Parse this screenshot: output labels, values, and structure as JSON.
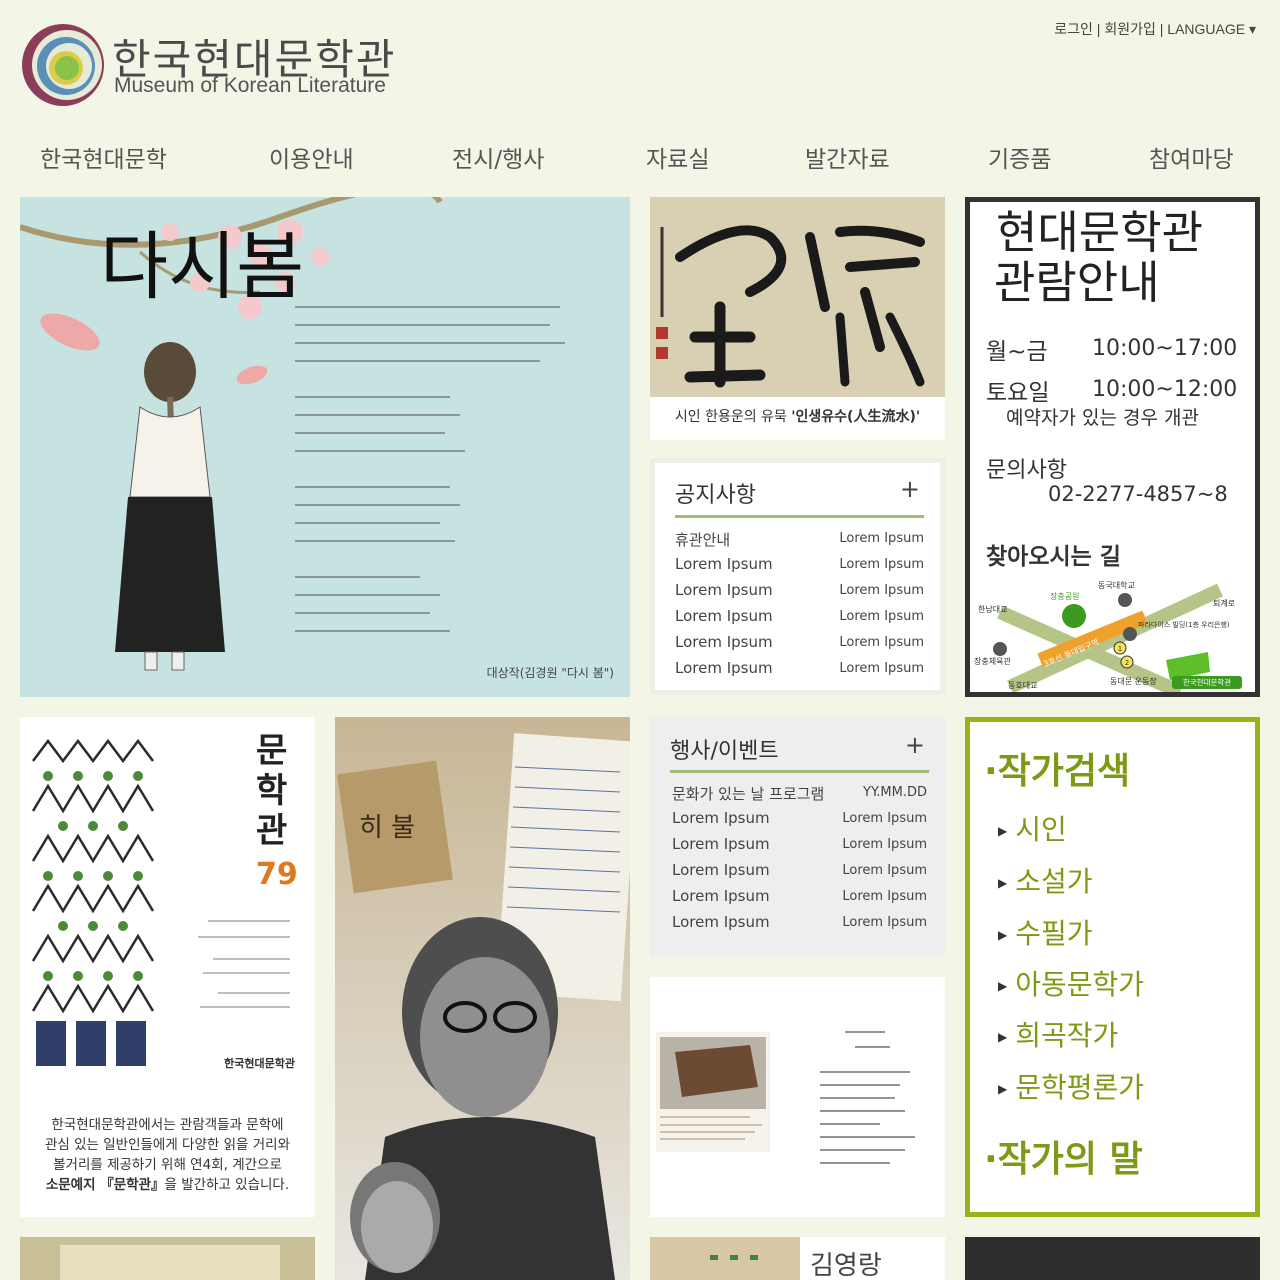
{
  "header": {
    "logo_ko": "한국현대문학관",
    "logo_en": "Museum of Korean Literature",
    "util": {
      "login": "로그인",
      "sep1": " | ",
      "join": "회원가입",
      "sep2": " | ",
      "language": "LANGUAGE ▾"
    }
  },
  "nav": [
    "한국현대문학",
    "이용안내",
    "전시/행사",
    "자료실",
    "발간자료",
    "기증품",
    "참여마당"
  ],
  "poster": {
    "title": "다시봄",
    "caption": "대상작(김경원 \"다시 봄\")"
  },
  "calligraphy": {
    "caption_prefix": "시인 한용운의 유묵 ",
    "caption_bold": "'인생유수(人生流水)'"
  },
  "info": {
    "title1": "현대문학관",
    "title2": "관람안내",
    "rows": [
      {
        "label": "월~금",
        "value": "10:00~17:00"
      },
      {
        "label": "토요일",
        "value": "10:00~12:00"
      }
    ],
    "note": "예약자가 있는 경우 개관",
    "contact_label": "문의사항",
    "phone": "02-2277-4857~8",
    "directions": "찾아오시는 길",
    "map": {
      "labels": [
        "장충공원",
        "동국대학교",
        "퇴계로",
        "한남대교",
        "파라다이스 빌딩(1층 우리은행)",
        "장충체육관",
        "3호선 동대입구역",
        "동호대교",
        "동대문 운동장",
        "한국현대문학관"
      ],
      "exits": [
        "1",
        "2"
      ],
      "colors": {
        "road": "#b5c487",
        "subway": "#f0a12b",
        "park": "#3c9a1f",
        "building": "#5fbf2a",
        "dot": "#555555"
      }
    }
  },
  "notice": {
    "title": "공지사항",
    "plus": "+",
    "rows": [
      {
        "title": "휴관안내",
        "date": "Lorem Ipsum"
      },
      {
        "title": "Lorem Ipsum",
        "date": "Lorem Ipsum"
      },
      {
        "title": "Lorem Ipsum",
        "date": "Lorem Ipsum"
      },
      {
        "title": "Lorem Ipsum",
        "date": "Lorem Ipsum"
      },
      {
        "title": "Lorem Ipsum",
        "date": "Lorem Ipsum"
      },
      {
        "title": "Lorem Ipsum",
        "date": "Lorem Ipsum"
      }
    ]
  },
  "events": {
    "title": "행사/이벤트",
    "plus": "+",
    "rows": [
      {
        "title": "문화가 있는 날 프로그램",
        "date": "YY.MM.DD"
      },
      {
        "title": "Lorem Ipsum",
        "date": "Lorem Ipsum"
      },
      {
        "title": "Lorem Ipsum",
        "date": "Lorem Ipsum"
      },
      {
        "title": "Lorem Ipsum",
        "date": "Lorem Ipsum"
      },
      {
        "title": "Lorem Ipsum",
        "date": "Lorem Ipsum"
      },
      {
        "title": "Lorem Ipsum",
        "date": "Lorem Ipsum"
      }
    ]
  },
  "magazine": {
    "cover_title": "문학관",
    "issue": "79",
    "publisher": "한국현대문학관",
    "desc1": "한국현대문학관에서는 관람객들과 문학에",
    "desc2": "관심 있는 일반인들에게 다양한 읽을 거리와",
    "desc3": "볼거리를 제공하기 위해 연4회, 계간으로",
    "desc4_bold": "소문예지 『문학관』",
    "desc4_rest": "을 발간하고 있습니다."
  },
  "portrait": {
    "book_title": "히 불"
  },
  "authors": {
    "head": "·작가검색",
    "items": [
      "시인",
      "소설가",
      "수필가",
      "아동문학가",
      "희곡작가",
      "문학평론가"
    ],
    "head2": "·작가의 말"
  },
  "bottom": {
    "author_name": "김영랑"
  }
}
